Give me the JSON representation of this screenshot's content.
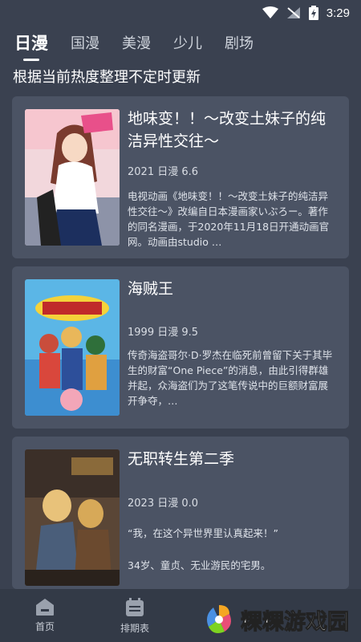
{
  "status": {
    "time": "3:29"
  },
  "tabs": [
    {
      "label": "日漫",
      "active": true
    },
    {
      "label": "国漫",
      "active": false
    },
    {
      "label": "美漫",
      "active": false
    },
    {
      "label": "少儿",
      "active": false
    },
    {
      "label": "剧场",
      "active": false
    }
  ],
  "subtitle": "根据当前热度整理不定时更新",
  "cards": [
    {
      "title": "地味变！！～改变土妹子的纯洁异性交往～",
      "meta": "2021  日漫  6.6",
      "desc": "电视动画《地味变！！～改变土妹子的纯洁异性交往～》改编自日本漫画家いぶろー。著作的同名漫画，于2020年11月18日开通动画官网。动画由studio …"
    },
    {
      "title": "海贼王",
      "meta": "1999  日漫  9.5",
      "desc": "传奇海盗哥尔·D·罗杰在临死前曾留下关于其毕生的财富“One Piece”的消息，由此引得群雄并起，众海盗们为了这笔传说中的巨额财富展开争夺，…"
    },
    {
      "title": "无职转生第二季",
      "meta": "2023  日漫  0.0",
      "desc": "“我，在这个异世界里认真起来！”",
      "desc2": "34岁、童贞、无业游民的宅男。"
    }
  ],
  "nav": [
    {
      "label": "首页",
      "icon": "home-icon"
    },
    {
      "label": "排期表",
      "icon": "calendar-icon"
    }
  ],
  "watermark": "粿粿游戏园",
  "colors": {
    "background": "#3a4150",
    "card": "#4b5364",
    "nav": "#333a47"
  }
}
